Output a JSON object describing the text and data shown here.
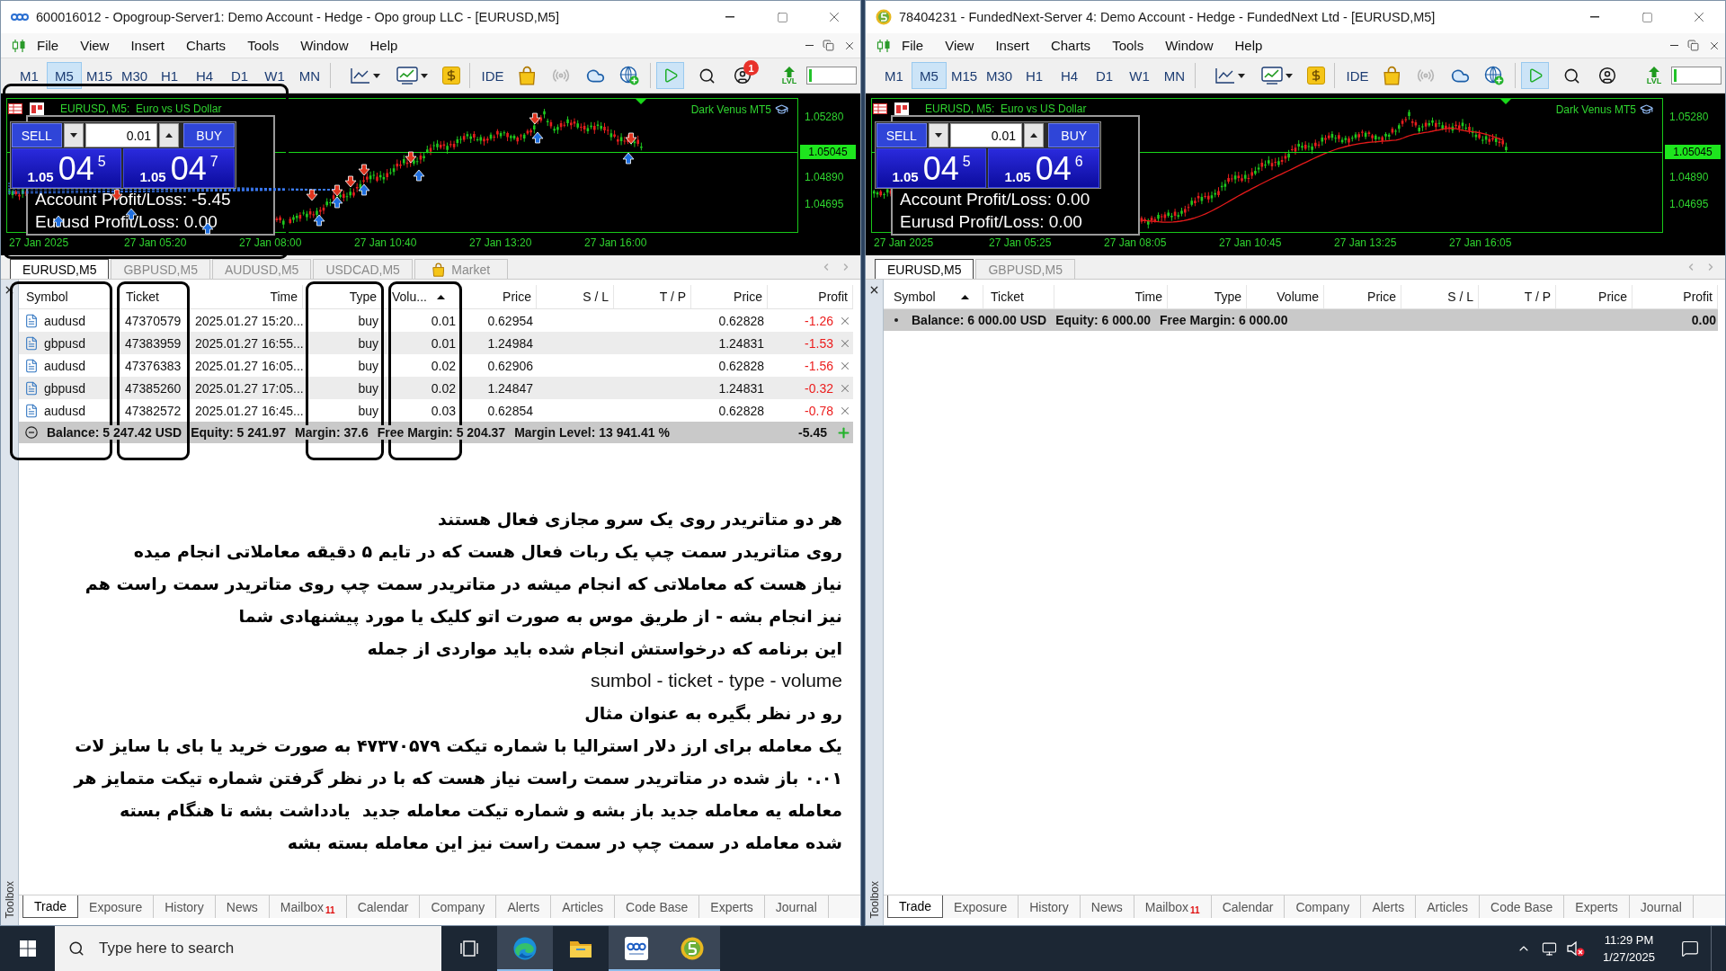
{
  "windows": [
    {
      "kind": "opo",
      "title": "600016012 - Opogroup-Server1: Demo Account - Hedge - Opo group LLC - [EURUSD,M5]",
      "menu": [
        "File",
        "View",
        "Insert",
        "Charts",
        "Tools",
        "Window",
        "Help"
      ],
      "timeframes": [
        {
          "label": "M1",
          "selected": false
        },
        {
          "label": "M5",
          "selected": true
        },
        {
          "label": "M15",
          "selected": false
        },
        {
          "label": "M30",
          "selected": false
        },
        {
          "label": "H1",
          "selected": false
        },
        {
          "label": "H4",
          "selected": false
        },
        {
          "label": "D1",
          "selected": false
        },
        {
          "label": "W1",
          "selected": false
        },
        {
          "label": "MN",
          "selected": false
        }
      ],
      "toolbar": {
        "ide": "IDE",
        "algo_trading": true,
        "notifications": "1",
        "lvl": "LVL",
        "meter": {
          "level": 0.06
        }
      },
      "chart": {
        "highlighted": true,
        "symbol": "EURUSD, M5:  Euro vs US Dollar",
        "indicator": "Dark Venus MT5",
        "prices": [
          {
            "label": "1.05280",
            "current": false
          },
          {
            "label": "1.05045",
            "current": true
          },
          {
            "label": "1.04890",
            "current": false
          },
          {
            "label": "1.04695",
            "current": false
          }
        ],
        "times": [
          "27 Jan 2025",
          "27 Jan 05:20",
          "27 Jan 08:00",
          "27 Jan 10:40",
          "27 Jan 13:20",
          "27 Jan 16:00"
        ],
        "trade_markers": true,
        "moving_average": false,
        "one_click": {
          "sell": "SELL",
          "buy": "BUY",
          "lot": "0.01",
          "bid": [
            "1.05",
            "04",
            "5"
          ],
          "ask": [
            "1.05",
            "04",
            "7"
          ]
        },
        "info": [
          "Account Profit/Loss: -5.45",
          "Eurusd Profit/Loss: 0.00"
        ]
      },
      "chart_tabs": [
        {
          "label": "EURUSD,M5",
          "kind": "chart",
          "selected": true
        },
        {
          "label": "GBPUSD,M5",
          "kind": "chart",
          "selected": false
        },
        {
          "label": "AUDUSD,M5",
          "kind": "chart",
          "selected": false
        },
        {
          "label": "USDCAD,M5",
          "kind": "chart",
          "selected": false
        },
        {
          "label": "Market",
          "kind": "market",
          "selected": false
        }
      ],
      "trade": {
        "columns": [
          {
            "label": "Symbol",
            "sorted": false,
            "highlighted": true
          },
          {
            "label": "Ticket",
            "sorted": false,
            "highlighted": true
          },
          {
            "label": "Time",
            "sorted": false,
            "highlighted": false
          },
          {
            "label": "Type",
            "sorted": false,
            "highlighted": true
          },
          {
            "label": "Volu...",
            "sorted": true,
            "highlighted": true
          },
          {
            "label": "Price",
            "sorted": false,
            "highlighted": false
          },
          {
            "label": "S / L",
            "sorted": false,
            "highlighted": false
          },
          {
            "label": "T / P",
            "sorted": false,
            "highlighted": false
          },
          {
            "label": "Price",
            "sorted": false,
            "highlighted": false
          },
          {
            "label": "Profit",
            "sorted": false,
            "highlighted": false
          }
        ],
        "rows": [
          {
            "symbol": "audusd",
            "ticket": "47370579",
            "time": "2025.01.27 15:20...",
            "type": "buy",
            "volume": "0.01",
            "price": "0.62954",
            "price_now": "0.62828",
            "profit": "-1.26",
            "loss": true
          },
          {
            "symbol": "gbpusd",
            "ticket": "47383959",
            "time": "2025.01.27 16:55...",
            "type": "buy",
            "volume": "0.01",
            "price": "1.24984",
            "price_now": "1.24831",
            "profit": "-1.53",
            "loss": true
          },
          {
            "symbol": "audusd",
            "ticket": "47376383",
            "time": "2025.01.27 16:05...",
            "type": "buy",
            "volume": "0.02",
            "price": "0.62906",
            "price_now": "0.62828",
            "profit": "-1.56",
            "loss": true
          },
          {
            "symbol": "gbpusd",
            "ticket": "47385260",
            "time": "2025.01.27 17:05...",
            "type": "buy",
            "volume": "0.02",
            "price": "1.24847",
            "price_now": "1.24831",
            "profit": "-0.32",
            "loss": true
          },
          {
            "symbol": "audusd",
            "ticket": "47382572",
            "time": "2025.01.27 16:45...",
            "type": "buy",
            "volume": "0.03",
            "price": "0.62854",
            "price_now": "0.62828",
            "profit": "-0.78",
            "loss": true
          }
        ],
        "summary": {
          "items": [
            "Balance: 5 247.42 USD",
            "Equity: 5 241.97",
            "Margin: 37.6",
            "Free Margin: 5 204.37",
            "Margin Level: 13 941.41 %"
          ],
          "profit": "-5.45",
          "add_button": true
        }
      },
      "note": [
        {
          "kind": "fa",
          "text": "هر دو متاتریدر روی یک سرو مجازی فعال هستند"
        },
        {
          "kind": "fa",
          "text": "روی متاتریدر سمت چپ یک ربات فعال هست که در تایم ۵ دقیقه معاملاتی انجام میده"
        },
        {
          "kind": "fa",
          "text": "نیاز هست که معاملاتی که انجام میشه در متاتریدر سمت چپ روی متاتریدر سمت راست هم"
        },
        {
          "kind": "fa",
          "text": "نیز انجام بشه - از طریق موس به صورت اتو کلیک یا مورد پیشنهادی شما"
        },
        {
          "kind": "fa",
          "text": "این برنامه که درخواستش انجام شده باید مواردی از جمله"
        },
        {
          "kind": "en",
          "text": "sumbol - ticket - type - volume"
        },
        {
          "kind": "fa",
          "text": "رو در نظر بگیره به عنوان مثال"
        },
        {
          "kind": "fa",
          "text": "یک معامله برای ارز دلار استرالیا با شماره تیکت ۴۷۳۷۰۵۷۹ به صورت خرید یا بای با سایز لات"
        },
        {
          "kind": "fa",
          "text": "۰.۰۱ باز شده در متاتریدر سمت راست نیاز هست که با در نظر گرفتن شماره تیکت متمایز هر"
        },
        {
          "kind": "fa",
          "text": "معامله یه معامله جدید باز بشه و شماره تیکت معامله جدید  یادداشت بشه تا هنگام بسته"
        },
        {
          "kind": "fa",
          "text": "شده معامله در سمت چپ در سمت راست نیز این معامله بسته بشه"
        }
      ],
      "bottom_tabs": [
        {
          "label": "Trade",
          "selected": true
        },
        {
          "label": "Exposure",
          "selected": false
        },
        {
          "label": "History",
          "selected": false
        },
        {
          "label": "News",
          "selected": false
        },
        {
          "label": "Mailbox",
          "selected": false,
          "badge": "11"
        },
        {
          "label": "Calendar",
          "selected": false
        },
        {
          "label": "Company",
          "selected": false
        },
        {
          "label": "Alerts",
          "selected": false
        },
        {
          "label": "Articles",
          "selected": false
        },
        {
          "label": "Code Base",
          "selected": false
        },
        {
          "label": "Experts",
          "selected": false
        },
        {
          "label": "Journal",
          "selected": false
        }
      ],
      "toolbox": "Toolbox"
    },
    {
      "kind": "terminal",
      "title": "78404231 - FundedNext-Server 4: Demo Account - Hedge - FundedNext Ltd - [EURUSD,M5]",
      "menu": [
        "File",
        "View",
        "Insert",
        "Charts",
        "Tools",
        "Window",
        "Help"
      ],
      "timeframes": [
        {
          "label": "M1",
          "selected": false
        },
        {
          "label": "M5",
          "selected": true
        },
        {
          "label": "M15",
          "selected": false
        },
        {
          "label": "M30",
          "selected": false
        },
        {
          "label": "H1",
          "selected": false
        },
        {
          "label": "H4",
          "selected": false
        },
        {
          "label": "D1",
          "selected": false
        },
        {
          "label": "W1",
          "selected": false
        },
        {
          "label": "MN",
          "selected": false
        }
      ],
      "toolbar": {
        "ide": "IDE",
        "algo_trading": true,
        "lvl": "LVL",
        "meter": {
          "level": 0.06
        }
      },
      "chart": {
        "highlighted": false,
        "symbol": "EURUSD, M5:  Euro vs US Dollar",
        "indicator": "Dark Venus MT5",
        "prices": [
          {
            "label": "1.05280",
            "current": false
          },
          {
            "label": "1.05045",
            "current": true
          },
          {
            "label": "1.04890",
            "current": false
          },
          {
            "label": "1.04695",
            "current": false
          }
        ],
        "times": [
          "27 Jan 2025",
          "27 Jan 05:25",
          "27 Jan 08:05",
          "27 Jan 10:45",
          "27 Jan 13:25",
          "27 Jan 16:05"
        ],
        "trade_markers": false,
        "moving_average": true,
        "one_click": {
          "sell": "SELL",
          "buy": "BUY",
          "lot": "0.01",
          "bid": [
            "1.05",
            "04",
            "5"
          ],
          "ask": [
            "1.05",
            "04",
            "6"
          ]
        },
        "info": [
          "Account Profit/Loss: 0.00",
          "Eurusd Profit/Loss: 0.00"
        ]
      },
      "chart_tabs": [
        {
          "label": "EURUSD,M5",
          "kind": "chart",
          "selected": true
        },
        {
          "label": "GBPUSD,M5",
          "kind": "chart",
          "selected": false
        }
      ],
      "trade": {
        "columns": [
          {
            "label": "Symbol",
            "sorted": true,
            "highlighted": false
          },
          {
            "label": "Ticket",
            "sorted": false,
            "highlighted": false
          },
          {
            "label": "Time",
            "sorted": false,
            "highlighted": false
          },
          {
            "label": "Type",
            "sorted": false,
            "highlighted": false
          },
          {
            "label": "Volume",
            "sorted": false,
            "highlighted": false
          },
          {
            "label": "Price",
            "sorted": false,
            "highlighted": false
          },
          {
            "label": "S / L",
            "sorted": false,
            "highlighted": false
          },
          {
            "label": "T / P",
            "sorted": false,
            "highlighted": false
          },
          {
            "label": "Price",
            "sorted": false,
            "highlighted": false
          },
          {
            "label": "Profit",
            "sorted": false,
            "highlighted": false
          }
        ],
        "summary": {
          "items": [
            "Balance: 6 000.00 USD",
            "Equity: 6 000.00",
            "Free Margin: 6 000.00"
          ],
          "profit": "0.00",
          "add_button": false
        }
      },
      "bottom_tabs": [
        {
          "label": "Trade",
          "selected": true
        },
        {
          "label": "Exposure",
          "selected": false
        },
        {
          "label": "History",
          "selected": false
        },
        {
          "label": "News",
          "selected": false
        },
        {
          "label": "Mailbox",
          "selected": false,
          "badge": "11"
        },
        {
          "label": "Calendar",
          "selected": false
        },
        {
          "label": "Company",
          "selected": false
        },
        {
          "label": "Alerts",
          "selected": false
        },
        {
          "label": "Articles",
          "selected": false
        },
        {
          "label": "Code Base",
          "selected": false
        },
        {
          "label": "Experts",
          "selected": false
        },
        {
          "label": "Journal",
          "selected": false
        }
      ],
      "toolbox": "Toolbox"
    }
  ],
  "taskbar": {
    "search": {
      "placeholder": "Type here to search"
    },
    "apps": [
      {
        "kind": "browser",
        "open": true
      },
      {
        "kind": "folder",
        "open": false
      },
      {
        "kind": "opo",
        "open": true
      },
      {
        "kind": "terminal",
        "open": true
      }
    ],
    "muted": true,
    "time": "11:29 PM",
    "date": "1/27/2025"
  }
}
